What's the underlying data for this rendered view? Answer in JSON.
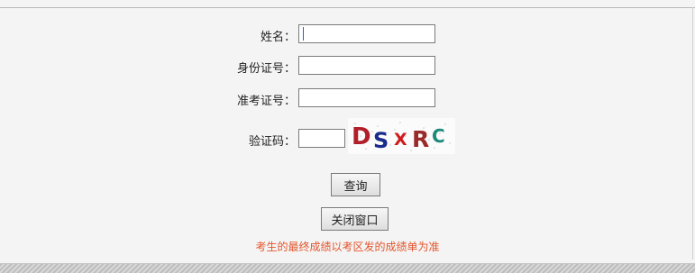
{
  "form": {
    "name_label": "姓名：",
    "id_label": "身份证号：",
    "exam_no_label": "准考证号：",
    "captcha_label": "验证码：",
    "name_value": "",
    "id_value": "",
    "exam_no_value": "",
    "captcha_value": ""
  },
  "captcha": {
    "text_chars": [
      "D",
      "S",
      "X",
      "R",
      "C"
    ],
    "colors": [
      "#b21d2a",
      "#1a2b8c",
      "#d11a1a",
      "#9a2a2a",
      "#1b8a7a"
    ]
  },
  "buttons": {
    "query_label": "查询",
    "close_label": "关闭窗口"
  },
  "note": "考生的最终成绩以考区发的成绩单为准",
  "colors": {
    "background": "#f4f4f4",
    "note": "#e3552c"
  }
}
